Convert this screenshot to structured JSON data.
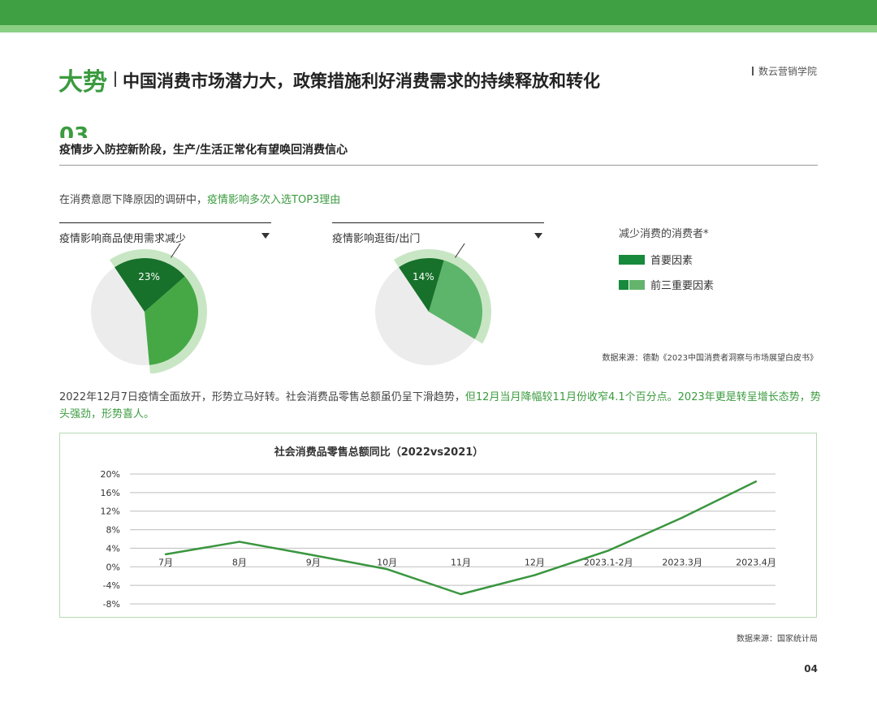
{
  "header": {
    "main": "大势",
    "subtitle": "中国消费市场潜力大，政策措施利好消费需求的持续释放和转化",
    "brand": "数云营销学院"
  },
  "section": {
    "number": "03",
    "title": "疫情步入防控新阶段，生产/生活正常化有望唤回消费信心"
  },
  "intro": {
    "plain": "在消费意愿下降原因的调研中，",
    "highlight": "疫情影响多次入选TOP3理由"
  },
  "pies": [
    {
      "dropdown": "疫情影响商品使用需求减少",
      "primary_pct": 23,
      "primary_label": "23%",
      "top3_pct": 58,
      "top3_label": "58%"
    },
    {
      "dropdown": "疫情影响逛街/出门",
      "primary_pct": 14,
      "primary_label": "14%",
      "top3_pct": 43,
      "top3_label": "43%"
    }
  ],
  "legend": {
    "title": "减少消费的消费者*",
    "items": [
      "首要因素",
      "前三重要因素"
    ]
  },
  "source1": "数据来源：德勤《2023中国消费者洞察与市场展望白皮书》",
  "paragraph": {
    "plain1": "2022年12月7日疫情全面放开，形势立马好转。社会消费品零售总额虽仍呈下滑趋势，",
    "highlight": "但12月当月降幅较11月份收窄4.1个百分点。2023年更是转呈增长态势，势头强劲，形势喜人。"
  },
  "colors": {
    "brand_green": "#3f9f43",
    "dark_green": "#178a3b",
    "mid_green": "#4fa94f",
    "light_green": "#c8e6c4",
    "pie_gray": "#ececec",
    "line": "#3a963f"
  },
  "chart_data": {
    "type": "line",
    "title": "社会消费品零售总额同比（2022vs2021）",
    "categories": [
      "7月",
      "8月",
      "9月",
      "10月",
      "11月",
      "12月",
      "2023.1-2月",
      "2023.3月",
      "2023.4月"
    ],
    "values": [
      2.7,
      5.4,
      2.5,
      -0.5,
      -5.9,
      -1.8,
      3.5,
      10.6,
      18.4
    ],
    "ylim": [
      -8,
      20
    ],
    "yticks": [
      20,
      16,
      12,
      8,
      4,
      0,
      -4,
      -8
    ],
    "ytick_labels": [
      "20%",
      "16%",
      "12%",
      "8%",
      "4%",
      "0%",
      "-4%",
      "-8%"
    ],
    "grid": true
  },
  "source2": "数据来源：国家统计局",
  "page_number": "04"
}
